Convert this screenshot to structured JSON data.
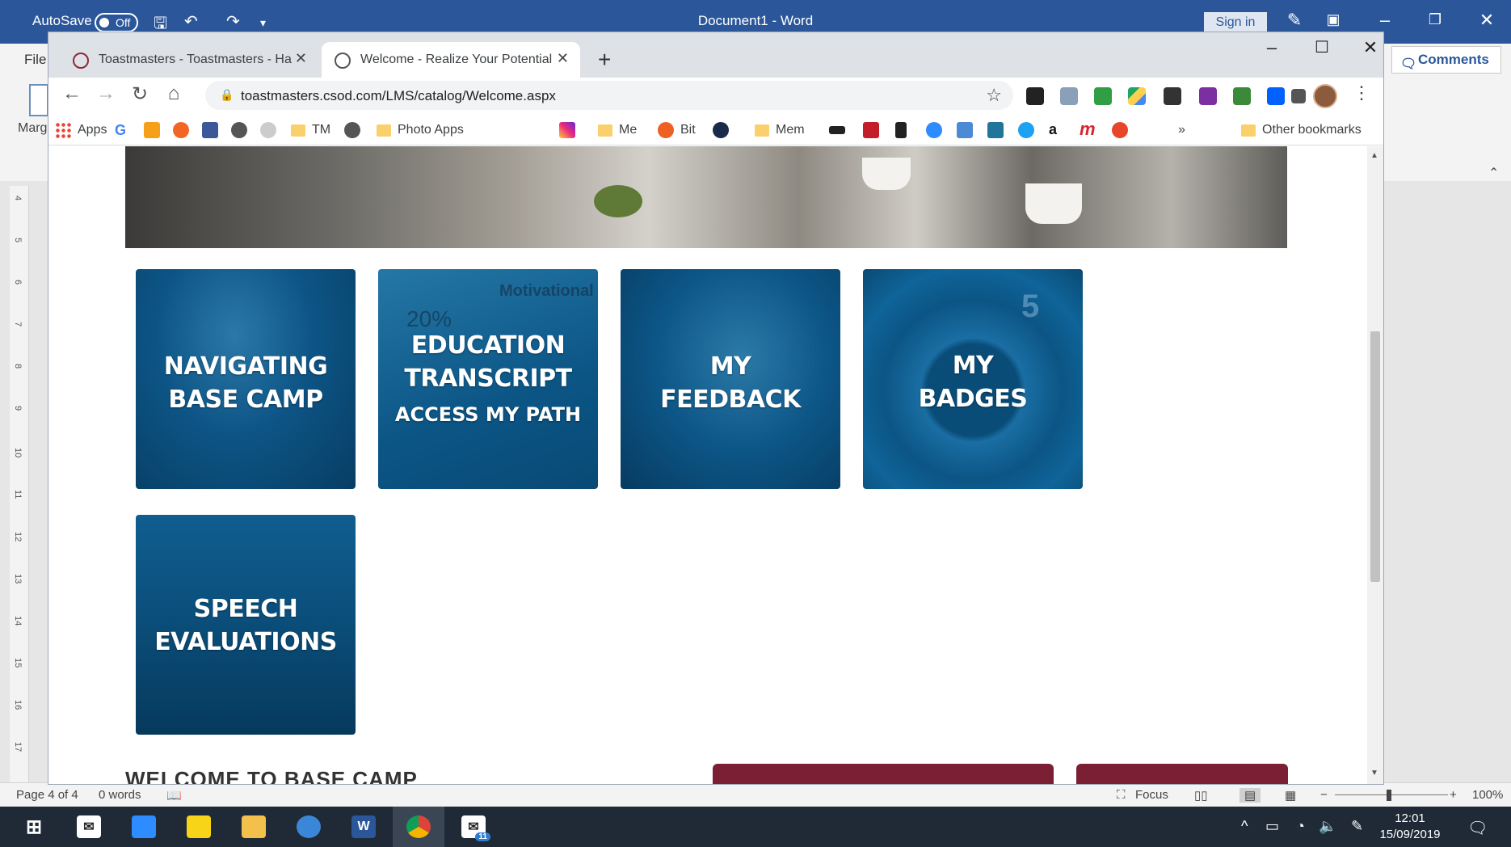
{
  "word": {
    "autosave_label": "AutoSave",
    "autosave_state": "Off",
    "title": "Document1  -  Word",
    "sign_in": "Sign in",
    "file_tab": "File",
    "margins_label": "Marg",
    "comments_label": "Comments",
    "ruler_ticks": [
      "4",
      "5",
      "6",
      "7",
      "8",
      "9",
      "10",
      "11",
      "12",
      "13",
      "14",
      "15",
      "16",
      "17"
    ],
    "status": {
      "page": "Page 4 of 4",
      "words": "0 words",
      "focus": "Focus",
      "zoom": "100%"
    }
  },
  "browser": {
    "tabs": [
      {
        "title": "Toastmasters - Toastmasters - Ha"
      },
      {
        "title": "Welcome - Realize Your Potential"
      }
    ],
    "url": "toastmasters.csod.com/LMS/catalog/Welcome.aspx",
    "bookmarks": {
      "apps": "Apps",
      "tm": "TM",
      "photo_apps": "Photo Apps",
      "me": "Me",
      "bit": "Bit",
      "mem": "Mem",
      "more": "»",
      "other": "Other bookmarks"
    }
  },
  "page": {
    "tiles": [
      {
        "line1": "NAVIGATING",
        "line2": "BASE CAMP"
      },
      {
        "line1": "EDUCATION",
        "line2": "TRANSCRIPT",
        "sub": "ACCESS MY PATH",
        "bg_percent": "20%",
        "bg_title": "Motivational"
      },
      {
        "line1": "MY",
        "line2": "FEEDBACK"
      },
      {
        "line1": "MY",
        "line2": "BADGES",
        "bg_number": "5"
      },
      {
        "line1": "SPEECH",
        "line2": "EVALUATIONS"
      }
    ],
    "welcome_heading": "WELCOME TO BASE CAMP"
  },
  "taskbar": {
    "time": "12:01",
    "date": "15/09/2019",
    "mail_badge": "11"
  },
  "colors": {
    "word_blue": "#2b579a",
    "tile_blue": "#0b5a8a",
    "maroon": "#7a1f34"
  }
}
